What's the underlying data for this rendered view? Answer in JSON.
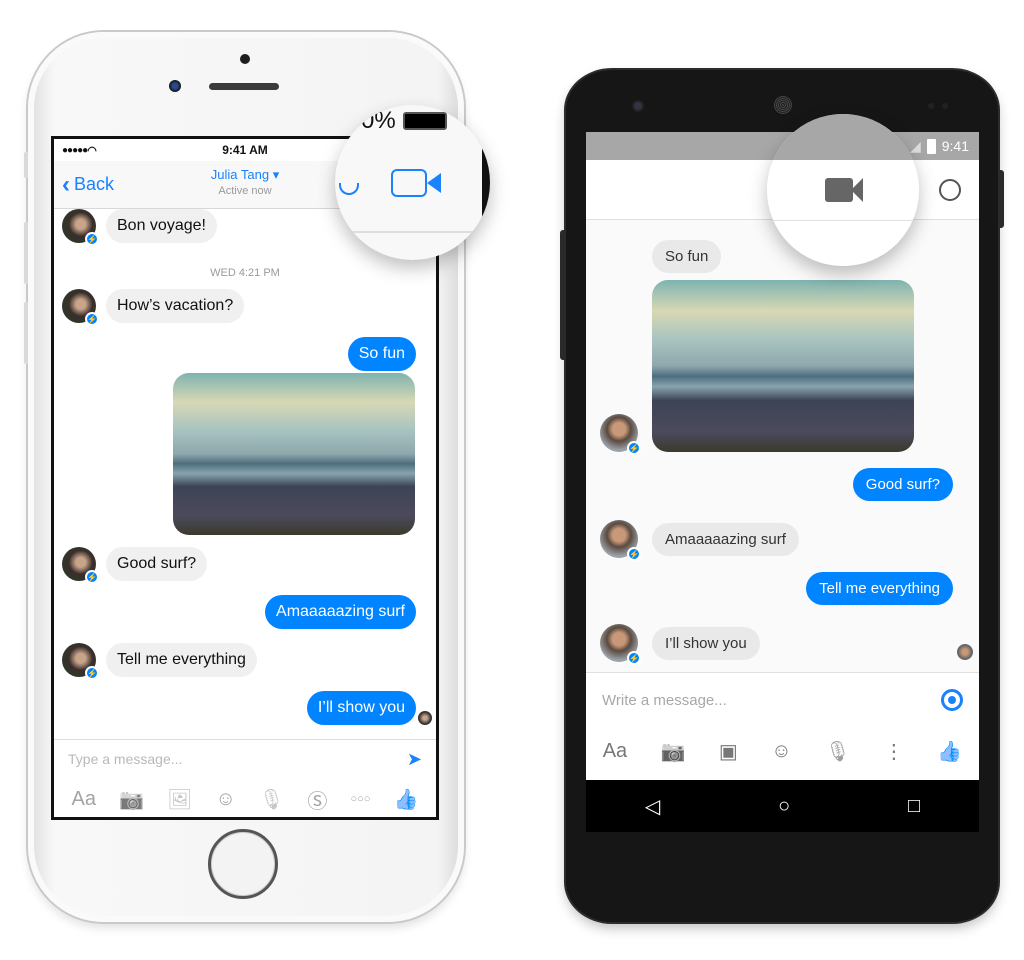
{
  "ios": {
    "status": {
      "signal": "●●●●● ",
      "wifi": "wifi",
      "time": "9:41 AM",
      "battery_text": "0%"
    },
    "nav": {
      "back_label": "Back",
      "contact_name": "Julia Tang",
      "dropdown": "▾",
      "presence": "Active now"
    },
    "messages": [
      {
        "side": "in",
        "text": "Bon voyage!"
      },
      {
        "type": "timestamp",
        "text": "WED 4:21 PM"
      },
      {
        "side": "in",
        "text": "How’s vacation?"
      },
      {
        "side": "out",
        "text": "So fun"
      },
      {
        "type": "photo",
        "side": "out",
        "description": "beach photo"
      },
      {
        "side": "in",
        "text": "Good surf?"
      },
      {
        "side": "out",
        "text": "Amaaaaazing surf"
      },
      {
        "side": "in",
        "text": "Tell me everything"
      },
      {
        "side": "out",
        "text": "I’ll show you"
      }
    ],
    "composer": {
      "placeholder": "Type a message...",
      "send_icon": "➤"
    },
    "toolbar": [
      {
        "name": "text-format",
        "glyph": "Aa"
      },
      {
        "name": "camera",
        "glyph": "📷"
      },
      {
        "name": "gallery",
        "glyph": "🖼"
      },
      {
        "name": "emoji",
        "glyph": "☺"
      },
      {
        "name": "microphone",
        "glyph": "🎙"
      },
      {
        "name": "payment",
        "glyph": "Ⓢ"
      },
      {
        "name": "more",
        "glyph": "○○○"
      },
      {
        "name": "like",
        "glyph": "👍"
      }
    ]
  },
  "android": {
    "status": {
      "time": "9:41"
    },
    "toolbar": [
      {
        "name": "text-format",
        "glyph": "Aa"
      },
      {
        "name": "camera",
        "glyph": "📷"
      },
      {
        "name": "gallery",
        "glyph": "▣"
      },
      {
        "name": "emoji",
        "glyph": "☺"
      },
      {
        "name": "microphone",
        "glyph": "🎙"
      },
      {
        "name": "more",
        "glyph": "⋮"
      },
      {
        "name": "like",
        "glyph": "👍"
      }
    ],
    "messages": [
      {
        "side": "in",
        "text": "So fun"
      },
      {
        "type": "photo",
        "side": "in",
        "description": "beach photo"
      },
      {
        "side": "out",
        "text": "Good surf?"
      },
      {
        "side": "in",
        "text": "Amaaaaazing surf"
      },
      {
        "side": "out",
        "text": "Tell me everything"
      },
      {
        "side": "in",
        "text": "I’ll show you"
      }
    ],
    "composer": {
      "placeholder": "Write a message..."
    },
    "navbar": {
      "back": "◁",
      "home": "○",
      "recents": "□"
    }
  },
  "colors": {
    "messenger_blue": "#0084ff",
    "ios_accent": "#1a82fb",
    "incoming_bubble": "#f0f0f0"
  }
}
